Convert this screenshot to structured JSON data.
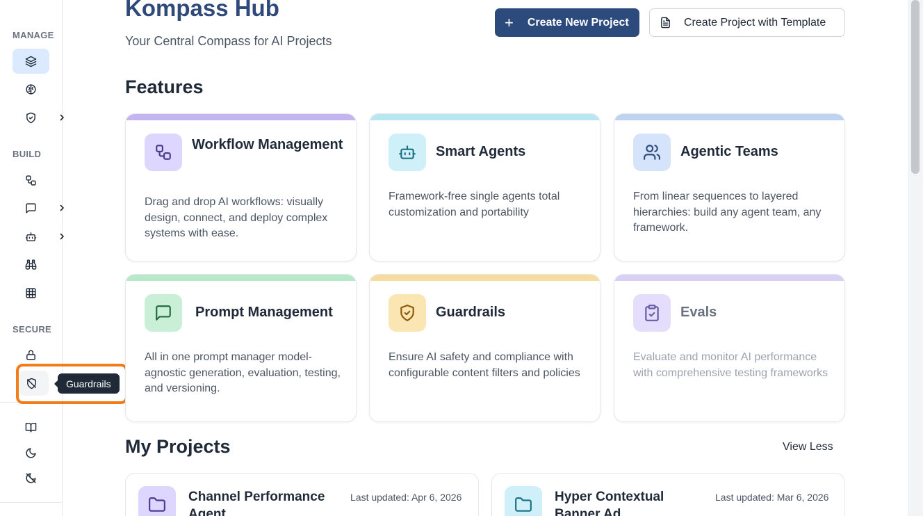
{
  "sidebar": {
    "sections": {
      "manage": "MANAGE",
      "build": "BUILD",
      "secure": "SECURE"
    },
    "items": [
      {
        "icon": "layers-icon",
        "active": true
      },
      {
        "icon": "brain-icon"
      },
      {
        "icon": "shield-check-icon",
        "has_submenu": true
      },
      {
        "icon": "workflow-icon"
      },
      {
        "icon": "message-square-icon",
        "has_submenu": true
      },
      {
        "icon": "bot-icon",
        "has_submenu": true
      },
      {
        "icon": "binoculars-icon"
      },
      {
        "icon": "table-grid-icon"
      },
      {
        "icon": "lock-icon"
      },
      {
        "icon": "shield-off-icon",
        "hovered": true
      },
      {
        "icon": "book-open-icon"
      },
      {
        "icon": "moon-icon"
      },
      {
        "icon": "moon-off-icon"
      }
    ],
    "tooltip": "Guardrails"
  },
  "header": {
    "title": "Kompass Hub",
    "subtitle": "Your Central Compass for AI Projects",
    "create_new": "Create New Project",
    "create_template": "Create Project with Template"
  },
  "features": {
    "heading": "Features",
    "cards": [
      {
        "title": "Workflow Management",
        "description": "Drag and drop AI workflows: visually design, connect, and deploy complex systems with ease.",
        "accent": "#c4b5f0",
        "icon_bg": "#ddd6fe",
        "icon": "workflow-icon"
      },
      {
        "title": "Smart Agents",
        "description": "Framework-free single agents total customization and portability",
        "accent": "#bae6f2",
        "icon_bg": "#cff0f8",
        "icon": "bot-icon"
      },
      {
        "title": "Agentic Teams",
        "description": "From linear sequences to layered hierarchies: build any agent team, any framework.",
        "accent": "#bfd3f0",
        "icon_bg": "#d6e4fb",
        "icon": "users-icon"
      },
      {
        "title": "Prompt Management",
        "description": "All in one prompt manager model-agnostic generation, evaluation, testing, and versioning.",
        "accent": "#b6e8c9",
        "icon_bg": "#c9f0d7",
        "icon": "message-square-icon"
      },
      {
        "title": "Guardrails",
        "description": "Ensure AI safety and compliance with configurable content filters and policies",
        "accent": "#f7dca0",
        "icon_bg": "#fbe6b3",
        "icon": "shield-check-icon"
      },
      {
        "title": "Evals",
        "description": "Evaluate and monitor AI performance with comprehensive testing frameworks",
        "accent": "#d9d0f6",
        "icon_bg": "#e4ddfb",
        "icon": "clipboard-check-icon",
        "dimmed": true
      }
    ]
  },
  "projects": {
    "heading": "My Projects",
    "view_toggle": "View Less",
    "items": [
      {
        "name": "Channel Performance Agent",
        "updated": "Last updated: Apr 6, 2026",
        "icon_bg": "#ddd6fe",
        "icon": "folder-icon"
      },
      {
        "name": "Hyper Contextual Banner Ad",
        "updated": "Last updated: Mar 6, 2026",
        "icon_bg": "#cff0f8",
        "icon": "folder-icon"
      }
    ]
  },
  "colors": {
    "primary": "#2d4a7d",
    "title": "#2f4a7a",
    "highlight": "#f07d1a",
    "tooltip_bg": "#1f2937"
  }
}
